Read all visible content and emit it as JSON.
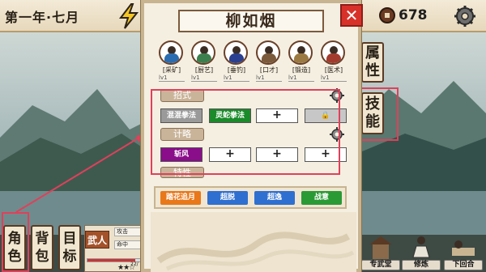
{
  "header": {
    "date": "第一年·七月",
    "coins": "678"
  },
  "panel": {
    "name": "柳如烟",
    "close_label": "✕",
    "skills": [
      {
        "name": "[采矿]",
        "level": "lv1",
        "color": "#2b6cb0"
      },
      {
        "name": "[厨艺]",
        "level": "lv1",
        "color": "#3c7f4e"
      },
      {
        "name": "[垂钓]",
        "level": "lv1",
        "color": "#2a3f8f"
      },
      {
        "name": "[口才]",
        "level": "lv1",
        "color": "#7a5a3a"
      },
      {
        "name": "[锻造]",
        "level": "lv1",
        "color": "#9a7a42"
      },
      {
        "name": "[医术]",
        "level": "lv1",
        "color": "#a23b2e"
      }
    ],
    "moves_header": "招式",
    "moves": [
      "混混拳法",
      "灵蛇拳法",
      "+",
      ""
    ],
    "strategy_header": "计略",
    "strategy": [
      "斩风",
      "+",
      "+",
      "+"
    ],
    "trait_header": "特性",
    "tactics": [
      {
        "label": "踏花追月",
        "color": "#e8781a"
      },
      {
        "label": "超脱",
        "color": "#2f6fd0"
      },
      {
        "label": "超逸",
        "color": "#2f6fd0"
      },
      {
        "label": "战意",
        "color": "#2a9a35"
      }
    ]
  },
  "right_tabs": {
    "attributes": [
      "属",
      "性"
    ],
    "skills": [
      "技",
      "能"
    ]
  },
  "bottom_left": {
    "role": [
      "角",
      "色"
    ],
    "bag": [
      "背",
      "包"
    ],
    "goal": [
      "目",
      "标"
    ],
    "class": "武人",
    "attack_label": "攻击",
    "hit_label": "命中",
    "hp_value": "22/",
    "hp_ratio": 0.9
  },
  "bottom_right": {
    "hall": "专武堂",
    "train": "修炼",
    "next": "下回合"
  }
}
